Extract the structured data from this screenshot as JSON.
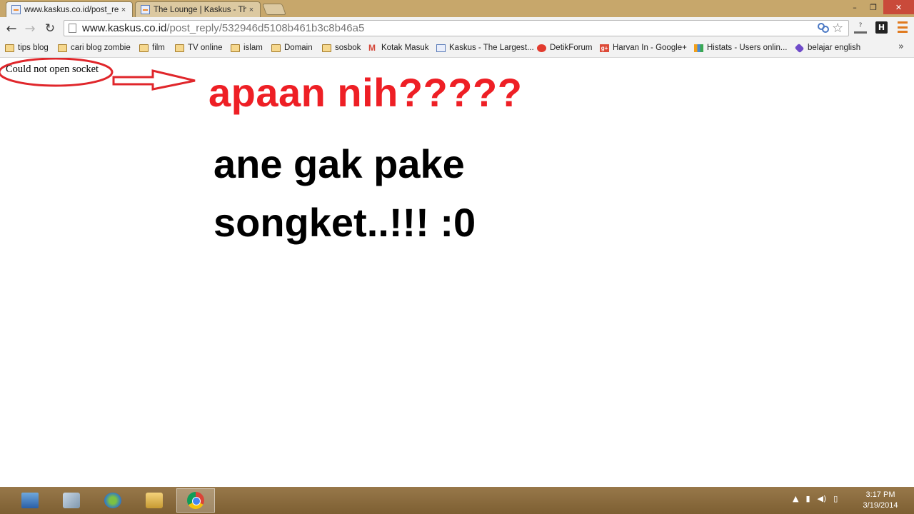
{
  "tabs": [
    {
      "title": "www.kaskus.co.id/post_re",
      "close": "×"
    },
    {
      "title": "The Lounge | Kaskus - The",
      "close": "×"
    }
  ],
  "window_controls": {
    "minimize": "–",
    "maximize": "❐",
    "close": "✕"
  },
  "nav": {
    "back": "←",
    "forward": "→",
    "reload": "↻"
  },
  "address_bar": {
    "host": "www.kaskus.co.id",
    "path": "/post_reply/532946d5108b461b3c8b46a5"
  },
  "toolbar_icons": {
    "translate": "translate-icon",
    "star": "☆",
    "ext1": "?",
    "ext2": "H",
    "menu": "menu-icon"
  },
  "bookmarks": [
    {
      "label": "tips blog",
      "icon": "folder"
    },
    {
      "label": "cari blog zombie",
      "icon": "folder"
    },
    {
      "label": "film",
      "icon": "folder"
    },
    {
      "label": "TV online",
      "icon": "folder"
    },
    {
      "label": "islam",
      "icon": "folder"
    },
    {
      "label": "Domain",
      "icon": "folder"
    },
    {
      "label": "sosbok",
      "icon": "folder"
    },
    {
      "label": "Kotak Masuk",
      "icon": "gmail"
    },
    {
      "label": "Kaskus - The Largest...",
      "icon": "kaskus"
    },
    {
      "label": "DetikForum",
      "icon": "detik"
    },
    {
      "label": "Harvan In - Google+",
      "icon": "gplus"
    },
    {
      "label": "Histats - Users onlin...",
      "icon": "histats"
    },
    {
      "label": "belajar english",
      "icon": "belajar"
    }
  ],
  "bookmarks_more": "»",
  "page": {
    "error_text": "Could not open socket",
    "headline_red": "apaan nih?????",
    "headline_black": "ane gak pake songket..!!! :0",
    "annotation_color": "#e0262b"
  },
  "taskbar": {
    "clock_time": "3:17 PM",
    "clock_date": "3/19/2014",
    "tray_icons": [
      "▲",
      "▮",
      "◀)",
      "▯"
    ]
  }
}
